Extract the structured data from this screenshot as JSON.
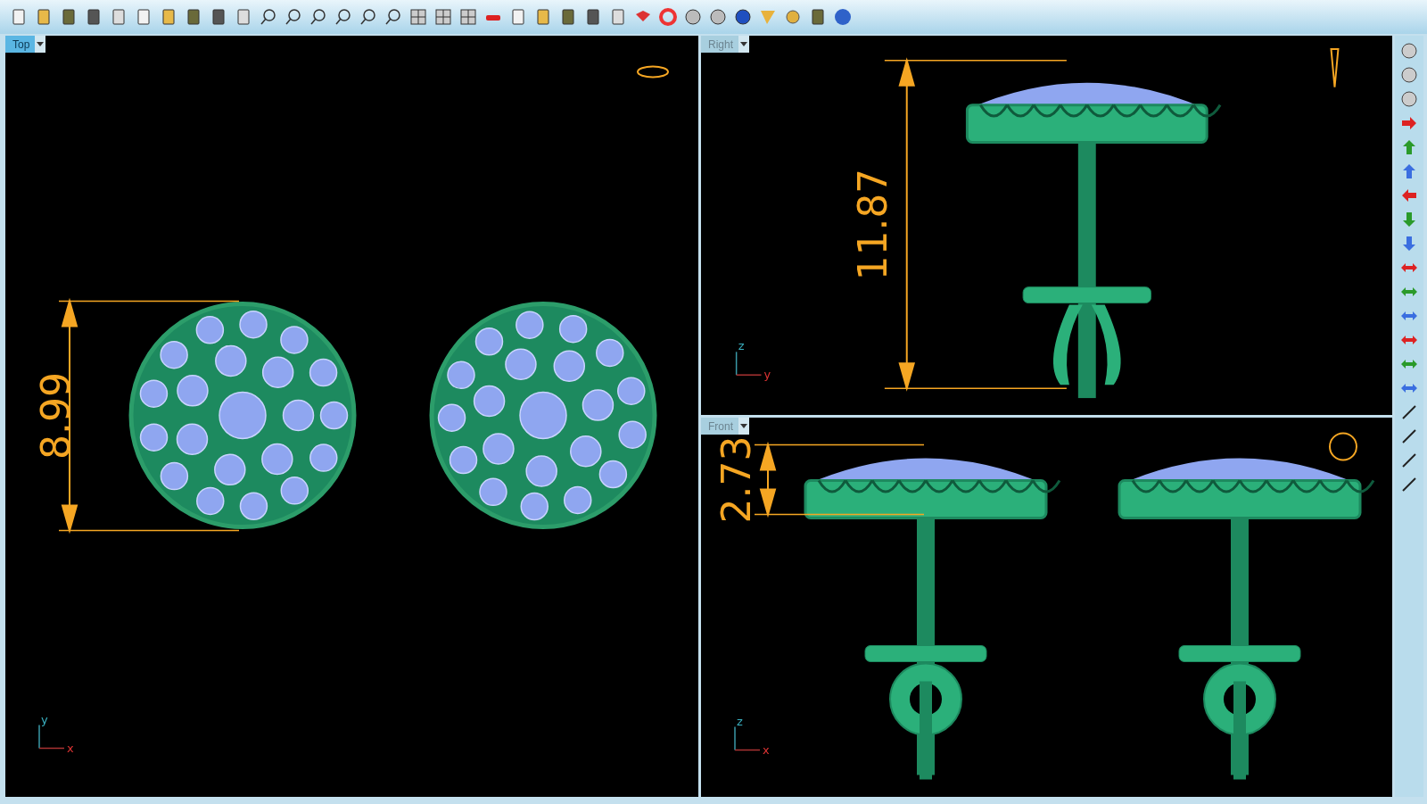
{
  "viewports": [
    {
      "kind": "top",
      "label": "Top",
      "selected": true,
      "dimension": "8.99",
      "axis": [
        "y",
        "x"
      ]
    },
    {
      "kind": "right",
      "label": "Right",
      "selected": false,
      "dimension": "11.87",
      "axis": [
        "z",
        "y"
      ]
    },
    {
      "kind": "front",
      "label": "Front",
      "selected": false,
      "dimension": "2.73",
      "axis": [
        "z",
        "x"
      ]
    }
  ]
}
